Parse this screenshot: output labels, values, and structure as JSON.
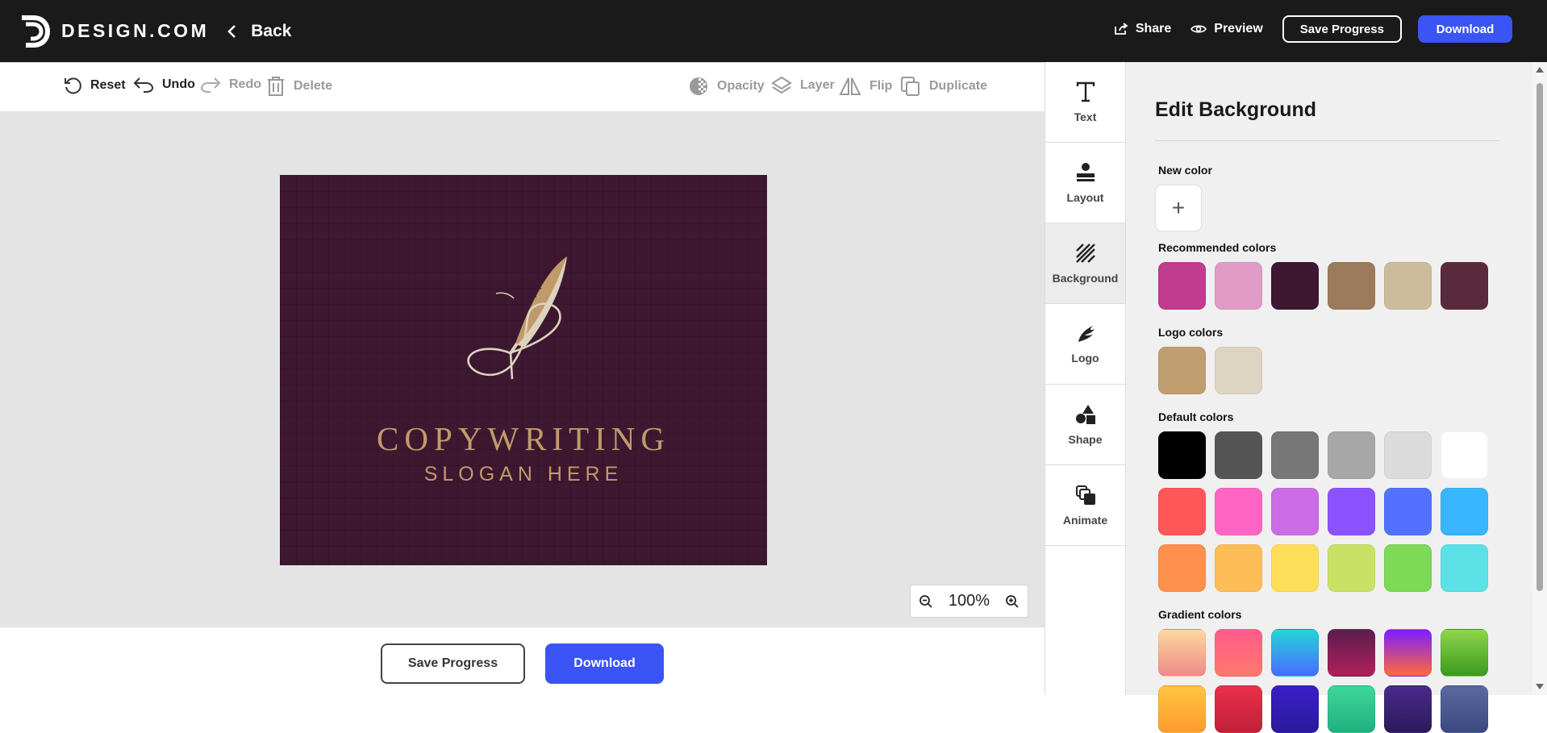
{
  "header": {
    "brand": "DESIGN.COM",
    "back_label": "Back",
    "share_label": "Share",
    "preview_label": "Preview",
    "save_label": "Save Progress",
    "download_label": "Download"
  },
  "toolbar": {
    "reset": "Reset",
    "undo": "Undo",
    "redo": "Redo",
    "delete": "Delete",
    "opacity": "Opacity",
    "layer": "Layer",
    "flip": "Flip",
    "duplicate": "Duplicate"
  },
  "canvas": {
    "background_color": "#3d1830",
    "logo_name": "COPYWRITING",
    "logo_slogan": "SLOGAN HERE",
    "zoom_level": "100%"
  },
  "footer": {
    "save_label": "Save Progress",
    "download_label": "Download"
  },
  "side_tabs": [
    {
      "label": "Text",
      "icon": "text-icon"
    },
    {
      "label": "Layout",
      "icon": "layout-icon"
    },
    {
      "label": "Background",
      "icon": "background-icon",
      "active": true
    },
    {
      "label": "Logo",
      "icon": "logo-icon"
    },
    {
      "label": "Shape",
      "icon": "shape-icon"
    },
    {
      "label": "Animate",
      "icon": "animate-icon"
    }
  ],
  "panel": {
    "title": "Edit Background",
    "new_color_label": "New color",
    "recommended_label": "Recommended colors",
    "logo_colors_label": "Logo colors",
    "default_colors_label": "Default colors",
    "gradient_colors_label": "Gradient colors",
    "recommended_colors": [
      "#c13b8f",
      "#e09cc6",
      "#3d1830",
      "#9c7b5c",
      "#cdbc9b",
      "#5a2a3c"
    ],
    "logo_colors": [
      "#c19e6f",
      "#ddd5c2"
    ],
    "default_colors": [
      [
        "#000000",
        "#555555",
        "#777777",
        "#a7a7a7",
        "#dadbda",
        "#ffffff"
      ],
      [
        "#ff5757",
        "#ff66c4",
        "#cb6ce6",
        "#8c52ff",
        "#5271ff",
        "#38b6ff"
      ],
      [
        "#ff914d",
        "#ffbd59",
        "#ffde59",
        "#c9e265",
        "#7ed957",
        "#5ce1e6"
      ]
    ],
    "gradient_colors": [
      [
        "linear-gradient(180deg,#fdd8a0,#f08a8a)",
        "linear-gradient(180deg,#ff5a8c,#ff7a6a)",
        "linear-gradient(180deg,#24d6d6,#4a6bff)",
        "linear-gradient(180deg,#5a1e4e,#b0205a)",
        "linear-gradient(180deg,#7b1eff,#ff6a3c)",
        "linear-gradient(180deg,#8ed64a,#3a9a1e)"
      ],
      [
        "linear-gradient(180deg,#ffc540,#ff9a30)",
        "linear-gradient(180deg,#e8304a,#c0203a)",
        "linear-gradient(180deg,#3a1ec8,#2a1a9a)",
        "linear-gradient(180deg,#3ed69a,#20b080)",
        "linear-gradient(180deg,#4a2a8a,#2a1a5a)",
        "linear-gradient(180deg,#5a6aa0,#3a4a80)"
      ]
    ]
  }
}
